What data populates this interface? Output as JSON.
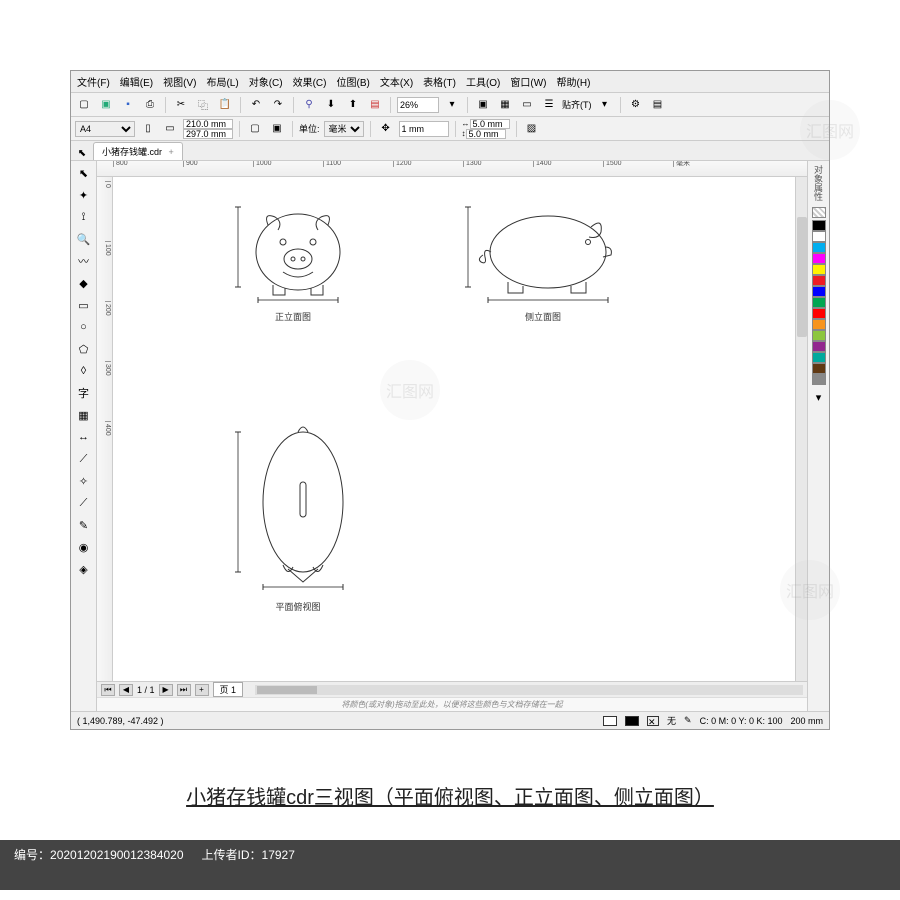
{
  "menu": {
    "file": "文件(F)",
    "edit": "编辑(E)",
    "view": "视图(V)",
    "layout": "布局(L)",
    "object": "对象(C)",
    "effects": "效果(C)",
    "bitmap": "位图(B)",
    "text": "文本(X)",
    "table": "表格(T)",
    "tools": "工具(O)",
    "window": "窗口(W)",
    "help": "帮助(H)"
  },
  "toolbar1": {
    "zoom": "26%",
    "paste": "贴齐(T)"
  },
  "toolbar2": {
    "paper": "A4",
    "width": "210.0 mm",
    "height": "297.0 mm",
    "units_label": "单位:",
    "units": "毫米",
    "nudge": "1 mm",
    "dup_x": "5.0 mm",
    "dup_y": "5.0 mm"
  },
  "tab": {
    "name": "小猪存钱罐.cdr",
    "close": "+"
  },
  "ruler_h": [
    "800",
    "900",
    "1000",
    "1100",
    "1200",
    "1300",
    "1400",
    "1500",
    "毫米"
  ],
  "ruler_v": [
    "0",
    "100",
    "200",
    "300",
    "400"
  ],
  "views": {
    "front": "正立面图",
    "side": "侧立面图",
    "top": "平面俯视图"
  },
  "pages": {
    "count": "1 / 1",
    "page1": "页 1"
  },
  "hint": "将颜色(或对象)拖动至此处，以便将这些颜色与文档存储在一起",
  "status": {
    "coords": "( 1,490.789, -47.492 )",
    "fill_none": "无",
    "c": "C: 0 M: 0 Y: 0 K: 100",
    "size": "200 mm"
  },
  "colors": [
    "#000000",
    "#ffffff",
    "#00aeef",
    "#ff00ff",
    "#fff200",
    "#ed1c24",
    "#0000ff",
    "#00a651",
    "#ff0000",
    "#f7941d",
    "#8dc63e",
    "#92278f",
    "#00a99d",
    "#603913",
    "#898989"
  ],
  "caption": "小猪存钱罐cdr三视图（平面俯视图、正立面图、侧立面图）",
  "meta": {
    "id_label": "编号：",
    "id": "2020120219001238402​0",
    "uploader_label": "上传者ID：",
    "uploader": "17927"
  },
  "sidebar_label": "对象属性"
}
